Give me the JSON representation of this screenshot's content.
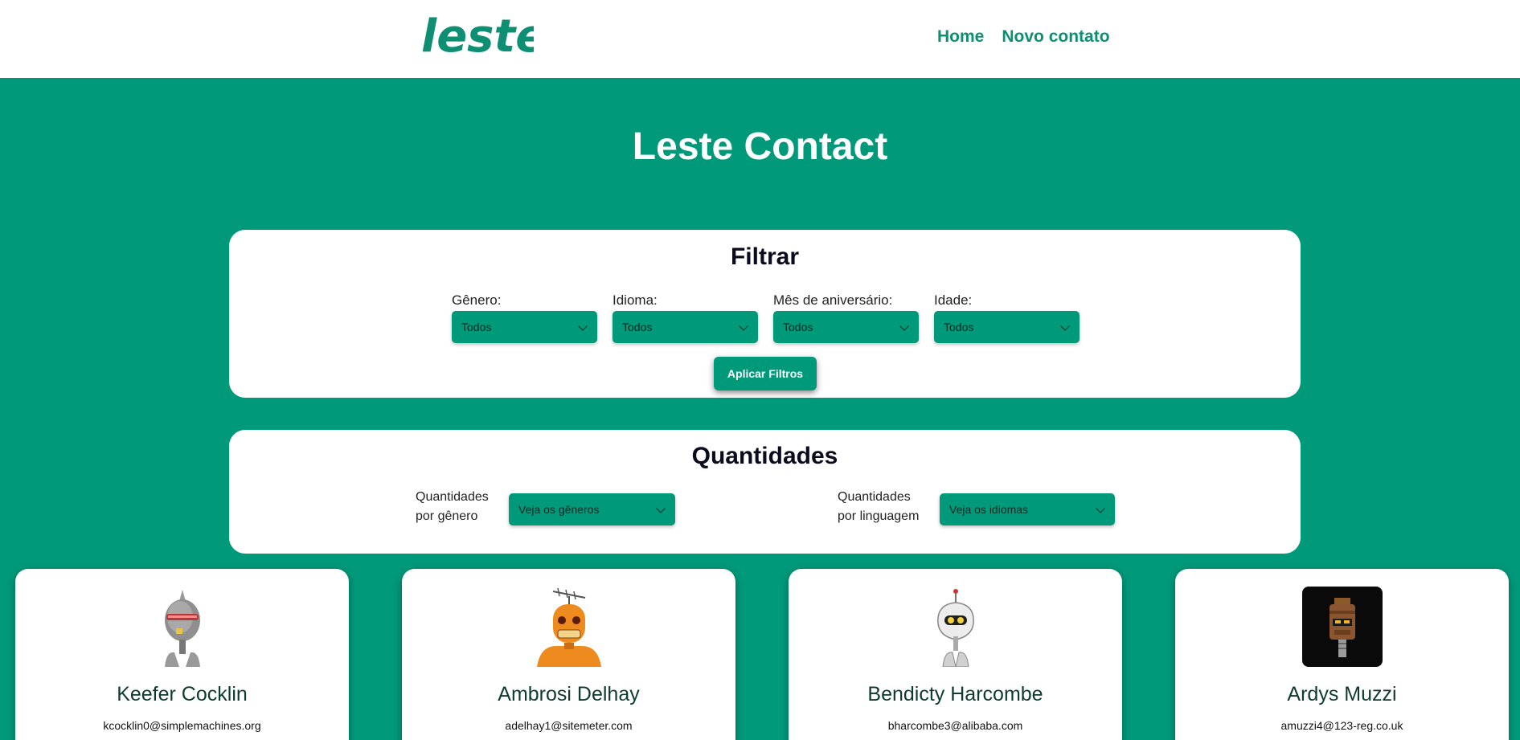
{
  "header": {
    "logo_text": "leste",
    "nav": [
      {
        "label": "Home"
      },
      {
        "label": "Novo contato"
      }
    ]
  },
  "hero": {
    "title": "Leste Contact"
  },
  "filter": {
    "title": "Filtrar",
    "fields": [
      {
        "label": "Gênero:",
        "value": "Todos"
      },
      {
        "label": "Idioma:",
        "value": "Todos"
      },
      {
        "label": "Mês de aniversário:",
        "value": "Todos"
      },
      {
        "label": "Idade:",
        "value": "Todos"
      }
    ],
    "apply_label": "Aplicar Filtros"
  },
  "quantities": {
    "title": "Quantidades",
    "gender": {
      "label_line1": "Quantidades",
      "label_line2": "por gênero",
      "value": "Veja os gêneros"
    },
    "language": {
      "label_line1": "Quantidades",
      "label_line2": "por linguagem",
      "value": "Veja os idiomas"
    }
  },
  "contacts": [
    {
      "name": "Keefer Cocklin",
      "email": "kcocklin0@simplemachines.org",
      "avatar": "grey-robot-icon"
    },
    {
      "name": "Ambrosi Delhay",
      "email": "adelhay1@sitemeter.com",
      "avatar": "orange-robot-icon"
    },
    {
      "name": "Bendicty Harcombe",
      "email": "bharcombe3@alibaba.com",
      "avatar": "white-robot-icon"
    },
    {
      "name": "Ardys Muzzi",
      "email": "amuzzi4@123-reg.co.uk",
      "avatar": "brown-robot-icon"
    }
  ],
  "colors": {
    "brand": "#00997a",
    "nav_text": "#0e8f74",
    "panel_bg": "#ffffff"
  }
}
